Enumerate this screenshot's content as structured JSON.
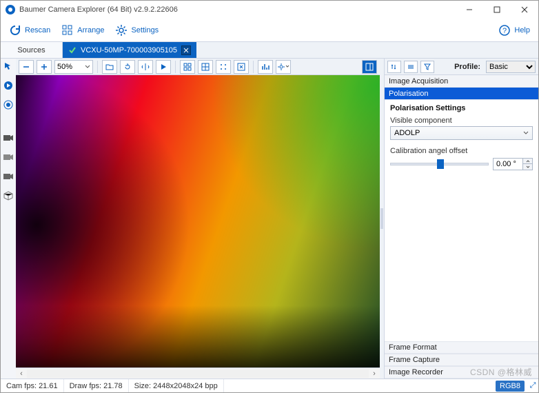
{
  "window": {
    "title": "Baumer Camera Explorer (64 Bit) v2.9.2.22606"
  },
  "toolbar": {
    "rescan": "Rescan",
    "arrange": "Arrange",
    "settings": "Settings",
    "help": "Help"
  },
  "sources_tab": "Sources",
  "device_tab": {
    "name": "VCXU-50MP-700003905105"
  },
  "view_toolbar": {
    "zoom": "50%"
  },
  "right_panel": {
    "profile_label": "Profile:",
    "profile_value": "Basic",
    "sections": {
      "image_acq": "Image Acquisition",
      "polarisation": "Polarisation",
      "frame_format": "Frame Format",
      "frame_capture": "Frame Capture",
      "image_recorder": "Image Recorder"
    },
    "pol": {
      "heading": "Polarisation Settings",
      "visible_component_label": "Visible component",
      "visible_component_value": "ADOLP",
      "calibration_label": "Calibration angel offset",
      "calibration_value": "0.00 °"
    }
  },
  "status": {
    "cam_fps": "Cam fps: 21.61",
    "draw_fps": "Draw fps: 21.78",
    "size": "Size: 2448x2048x24 bpp",
    "rgb_badge": "RGB8"
  },
  "watermark": "CSDN @格林威"
}
